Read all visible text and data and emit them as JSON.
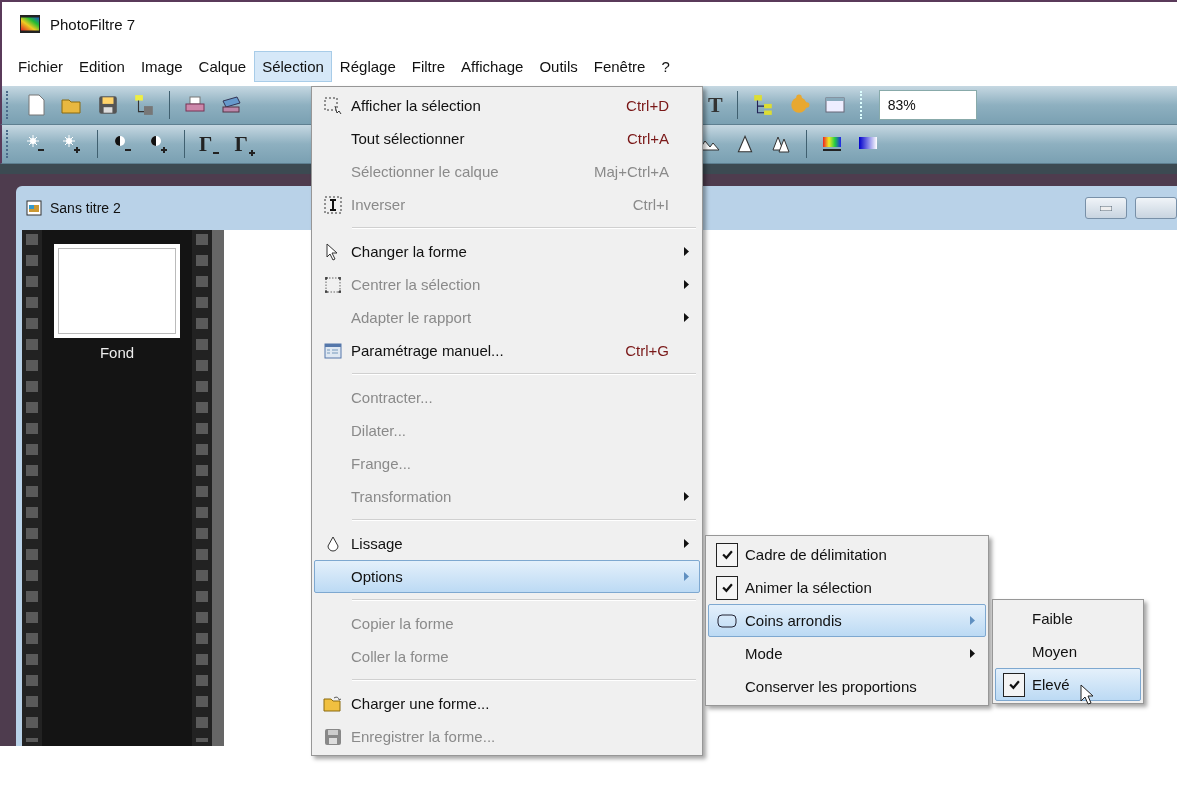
{
  "window": {
    "title": "PhotoFiltre 7"
  },
  "menu_bar": [
    {
      "label": "Fichier",
      "selected": false
    },
    {
      "label": "Edition",
      "selected": false
    },
    {
      "label": "Image",
      "selected": false
    },
    {
      "label": "Calque",
      "selected": false
    },
    {
      "label": "Sélection",
      "selected": true
    },
    {
      "label": "Réglage",
      "selected": false
    },
    {
      "label": "Filtre",
      "selected": false
    },
    {
      "label": "Affichage",
      "selected": false
    },
    {
      "label": "Outils",
      "selected": false
    },
    {
      "label": "Fenêtre",
      "selected": false
    },
    {
      "label": "?",
      "selected": false
    }
  ],
  "toolbar": {
    "text_tool": "T",
    "gamma_tools": [
      "Γ",
      "Γ"
    ],
    "zoom": "83%"
  },
  "document": {
    "title": "Sans titre 2",
    "layers": [
      {
        "name": "Fond"
      }
    ]
  },
  "selection_menu": {
    "items": [
      {
        "kind": "item",
        "label": "Afficher la sélection",
        "shortcut": "Ctrl+D",
        "disabled": false,
        "submenu": false,
        "selected": false
      },
      {
        "kind": "item",
        "label": "Tout sélectionner",
        "shortcut": "Ctrl+A",
        "disabled": false,
        "submenu": false,
        "selected": false
      },
      {
        "kind": "item",
        "label": "Sélectionner le calque",
        "shortcut": "Maj+Ctrl+A",
        "disabled": true,
        "submenu": false,
        "selected": false
      },
      {
        "kind": "item",
        "label": "Inverser",
        "shortcut": "Ctrl+I",
        "disabled": true,
        "submenu": false,
        "selected": false
      },
      {
        "kind": "separator"
      },
      {
        "kind": "item",
        "label": "Changer la forme",
        "disabled": false,
        "submenu": true,
        "selected": false
      },
      {
        "kind": "item",
        "label": "Centrer la sélection",
        "disabled": true,
        "submenu": true,
        "selected": false
      },
      {
        "kind": "item",
        "label": "Adapter le rapport",
        "disabled": true,
        "submenu": true,
        "selected": false
      },
      {
        "kind": "item",
        "label": "Paramétrage manuel...",
        "shortcut": "Ctrl+G",
        "disabled": false,
        "submenu": false,
        "selected": false
      },
      {
        "kind": "separator"
      },
      {
        "kind": "item",
        "label": "Contracter...",
        "disabled": true,
        "submenu": false,
        "selected": false
      },
      {
        "kind": "item",
        "label": "Dilater...",
        "disabled": true,
        "submenu": false,
        "selected": false
      },
      {
        "kind": "item",
        "label": "Frange...",
        "disabled": true,
        "submenu": false,
        "selected": false
      },
      {
        "kind": "item",
        "label": "Transformation",
        "disabled": true,
        "submenu": true,
        "selected": false
      },
      {
        "kind": "separator"
      },
      {
        "kind": "item",
        "label": "Lissage",
        "disabled": false,
        "submenu": true,
        "selected": false
      },
      {
        "kind": "item",
        "label": "Options",
        "disabled": false,
        "submenu": true,
        "selected": true
      },
      {
        "kind": "separator"
      },
      {
        "kind": "item",
        "label": "Copier la forme",
        "disabled": true,
        "submenu": false,
        "selected": false
      },
      {
        "kind": "item",
        "label": "Coller la forme",
        "disabled": true,
        "submenu": false,
        "selected": false
      },
      {
        "kind": "separator"
      },
      {
        "kind": "item",
        "label": "Charger une forme...",
        "disabled": false,
        "submenu": false,
        "selected": false
      },
      {
        "kind": "item",
        "label": "Enregistrer la forme...",
        "disabled": true,
        "submenu": false,
        "selected": false
      }
    ]
  },
  "options_submenu": {
    "items": [
      {
        "label": "Cadre de délimitation",
        "checked": true,
        "submenu": false,
        "selected": false
      },
      {
        "label": "Animer la sélection",
        "checked": true,
        "submenu": false,
        "selected": false
      },
      {
        "label": "Coins arrondis",
        "checked": false,
        "submenu": true,
        "selected": true
      },
      {
        "label": "Mode",
        "checked": false,
        "submenu": true,
        "selected": false
      },
      {
        "label": "Conserver les proportions",
        "checked": false,
        "submenu": false,
        "selected": false
      }
    ]
  },
  "rounded_corners_submenu": {
    "items": [
      {
        "label": "Faible",
        "checked": false,
        "selected": false
      },
      {
        "label": "Moyen",
        "checked": false,
        "selected": false
      },
      {
        "label": "Elevé",
        "checked": true,
        "selected": true
      }
    ]
  }
}
